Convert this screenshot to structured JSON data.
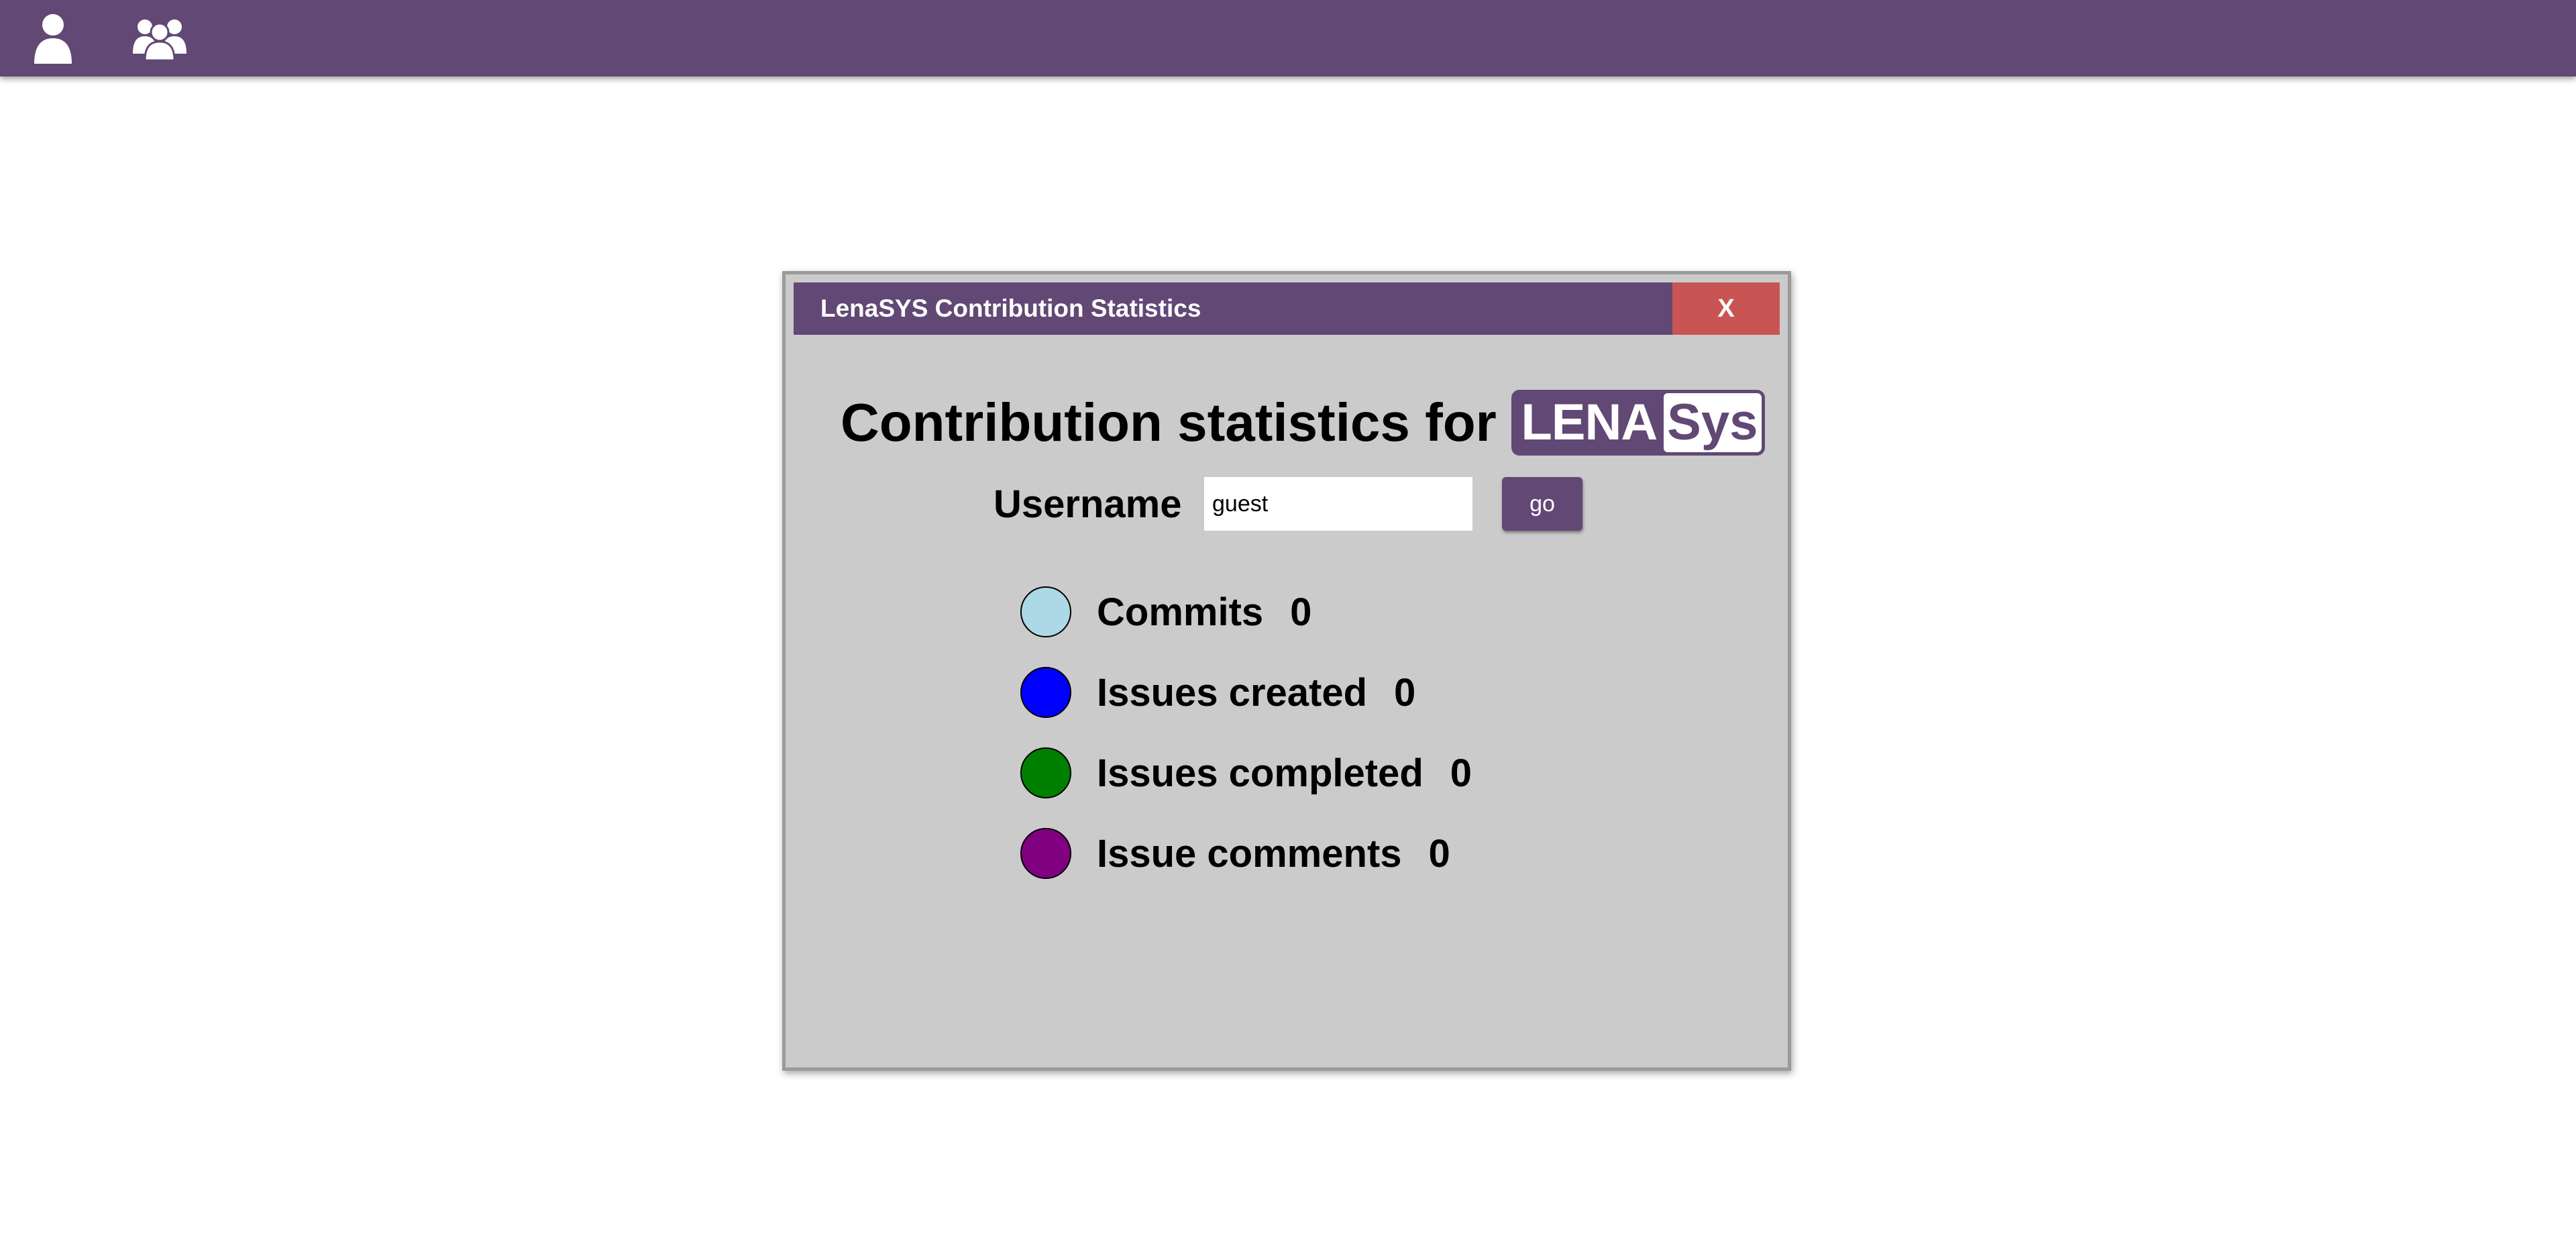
{
  "topbar": {
    "background": "#614875",
    "icons": [
      "user-icon",
      "group-icon"
    ]
  },
  "dialog": {
    "title": "LenaSYS Contribution Statistics",
    "close_label": "X",
    "close_color": "#c95454",
    "heading": "Contribution statistics for",
    "logo": {
      "part1": "LENA",
      "part2": "Sys",
      "color": "#614875"
    },
    "username": {
      "label": "Username",
      "value": "guest",
      "placeholder": ""
    },
    "go_label": "go",
    "stats": [
      {
        "label": "Commits",
        "value": "0",
        "color": "#add8e6"
      },
      {
        "label": "Issues created",
        "value": "0",
        "color": "#0000ff"
      },
      {
        "label": "Issues completed",
        "value": "0",
        "color": "#008000"
      },
      {
        "label": "Issue comments",
        "value": "0",
        "color": "#800080"
      }
    ]
  }
}
